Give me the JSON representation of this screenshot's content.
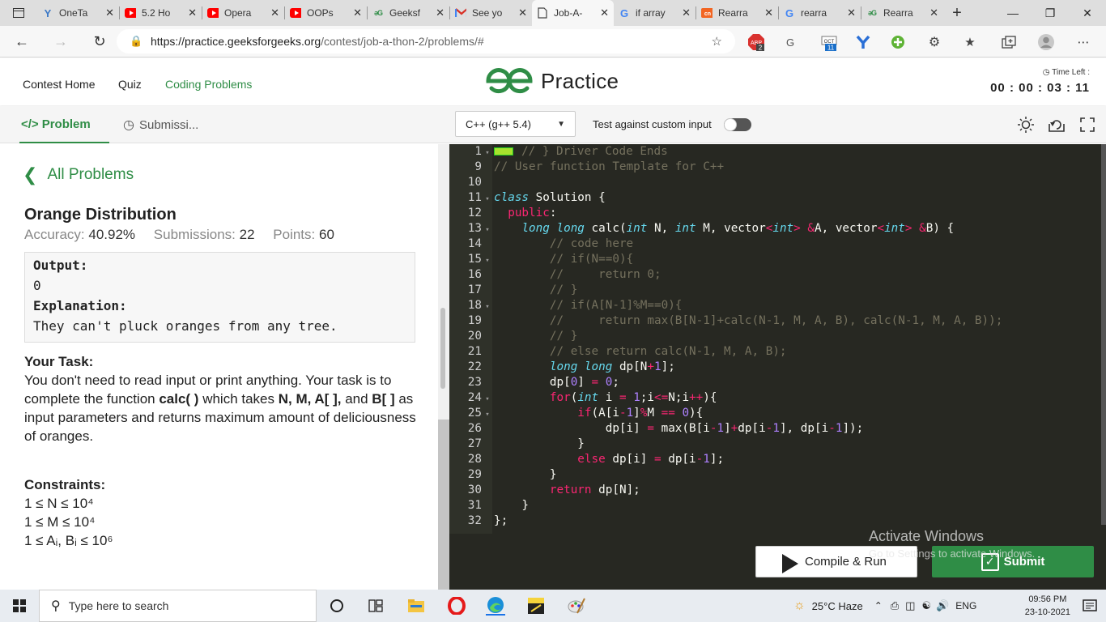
{
  "browser": {
    "tabs": [
      {
        "title": "OneTa",
        "fav": "Y",
        "color": "#3b78c6"
      },
      {
        "title": "5.2 Ho",
        "fav": "youtube",
        "color": "#ff0000"
      },
      {
        "title": "Opera",
        "fav": "youtube",
        "color": "#ff0000"
      },
      {
        "title": "OOPs",
        "fav": "youtube",
        "color": "#ff0000"
      },
      {
        "title": "Geeksf",
        "fav": "gfg",
        "color": "#2f8d46"
      },
      {
        "title": "See yo",
        "fav": "gmail",
        "color": "#d93025"
      },
      {
        "title": "Job-A-",
        "fav": "doc",
        "color": "#444444",
        "active": true
      },
      {
        "title": "if array",
        "fav": "G",
        "color": "#4285f4"
      },
      {
        "title": "Rearra",
        "fav": "cn",
        "color": "#f26522"
      },
      {
        "title": "rearra",
        "fav": "G",
        "color": "#4285f4"
      },
      {
        "title": "Rearra",
        "fav": "gfg",
        "color": "#2f8d46"
      }
    ],
    "url_host": "https://practice.geeksforgeeks.org",
    "url_path": "/contest/job-a-thon-2/problems/#",
    "ext_badge_1": "2",
    "ext_badge_2": "11"
  },
  "header": {
    "nav": [
      "Contest Home",
      "Quiz",
      "Coding Problems"
    ],
    "logo_text": "Practice",
    "time_left_label": "Time Left :",
    "time_left_value": "00 : 00 : 03 : 11"
  },
  "toolbar": {
    "problem_tab": "Problem",
    "submissions_tab": "Submissi...",
    "language": "C++ (g++ 5.4)",
    "custom_input_label": "Test against custom input"
  },
  "problem": {
    "back_label": "All Problems",
    "title": "Orange Distribution",
    "accuracy_label": "Accuracy:",
    "accuracy_value": "40.92%",
    "submissions_label": "Submissions:",
    "submissions_value": "22",
    "points_label": "Points:",
    "points_value": "60",
    "output_label": "Output:",
    "output_value": "0",
    "explanation_label": "Explanation:",
    "explanation_value": "They can't pluck oranges from any tree.",
    "task_heading": "Your Task:",
    "task_text_1": "You don't need to read input or print anything. Your task is to complete the function ",
    "task_fn": "calc( )",
    "task_text_2": " which takes ",
    "task_params": "N, M, A[ ],",
    "task_text_3": "  and ",
    "task_param_b": "B[ ]",
    "task_text_4": "  as input parameters and returns maximum amount of deliciousness of oranges.",
    "constraints_heading": "Constraints:",
    "constraints": [
      "1 ≤ N ≤ 10⁴",
      "1 ≤ M ≤ 10⁴",
      "1 ≤ Aᵢ, Bᵢ ≤ 10⁶"
    ]
  },
  "editor": {
    "lines": [
      {
        "n": "1",
        "fold": true,
        "html": "<span class='cm'>// } Driver Code Ends</span>"
      },
      {
        "n": "9",
        "html": "<span class='cm'>// User function Template for C++</span>"
      },
      {
        "n": "10",
        "html": ""
      },
      {
        "n": "11",
        "fold": true,
        "html": "<span class='kw'>class</span> Solution {"
      },
      {
        "n": "12",
        "html": "  <span class='kw2'>public</span>:"
      },
      {
        "n": "13",
        "fold": true,
        "html": "    <span class='ty'>long long</span> calc(<span class='ty'>int</span> N, <span class='ty'>int</span> M, vector<span class='op'>&lt;</span><span class='ty'>int</span><span class='op'>&gt;</span> <span class='op'>&amp;</span>A, vector<span class='op'>&lt;</span><span class='ty'>int</span><span class='op'>&gt;</span> <span class='op'>&amp;</span>B) {"
      },
      {
        "n": "14",
        "html": "        <span class='cm'>// code here</span>"
      },
      {
        "n": "15",
        "fold": true,
        "html": "        <span class='cm'>// if(N==0){</span>"
      },
      {
        "n": "16",
        "html": "        <span class='cm'>//     return 0;</span>"
      },
      {
        "n": "17",
        "html": "        <span class='cm'>// }</span>"
      },
      {
        "n": "18",
        "fold": true,
        "html": "        <span class='cm'>// if(A[N-1]%M==0){</span>"
      },
      {
        "n": "19",
        "html": "        <span class='cm'>//     return max(B[N-1]+calc(N-1, M, A, B), calc(N-1, M, A, B));</span>"
      },
      {
        "n": "20",
        "html": "        <span class='cm'>// }</span>"
      },
      {
        "n": "21",
        "html": "        <span class='cm'>// else return calc(N-1, M, A, B);</span>"
      },
      {
        "n": "22",
        "html": "        <span class='ty'>long long</span> dp[N<span class='op'>+</span><span class='num'>1</span>];"
      },
      {
        "n": "23",
        "html": "        dp[<span class='num'>0</span>] <span class='op'>=</span> <span class='num'>0</span>;"
      },
      {
        "n": "24",
        "fold": true,
        "html": "        <span class='kw2'>for</span>(<span class='ty'>int</span> i <span class='op'>=</span> <span class='num'>1</span>;i<span class='op'>&lt;=</span>N;i<span class='op'>++</span>){"
      },
      {
        "n": "25",
        "fold": true,
        "html": "            <span class='kw2'>if</span>(A[i<span class='op'>-</span><span class='num'>1</span>]<span class='op'>%</span>M <span class='op'>==</span> <span class='num'>0</span>){"
      },
      {
        "n": "26",
        "html": "                dp[i] <span class='op'>=</span> max(B[i<span class='op'>-</span><span class='num'>1</span>]<span class='op'>+</span>dp[i<span class='op'>-</span><span class='num'>1</span>], dp[i<span class='op'>-</span><span class='num'>1</span>]);"
      },
      {
        "n": "27",
        "html": "            }"
      },
      {
        "n": "28",
        "html": "            <span class='kw2'>else</span> dp[i] <span class='op'>=</span> dp[i<span class='op'>-</span><span class='num'>1</span>];"
      },
      {
        "n": "29",
        "html": "        }"
      },
      {
        "n": "30",
        "html": "        <span class='kw2'>return</span> dp[N];"
      },
      {
        "n": "31",
        "html": "    }"
      },
      {
        "n": "32",
        "html": "};"
      }
    ]
  },
  "actions": {
    "compile_label": "Compile & Run",
    "submit_label": "Submit"
  },
  "watermark": {
    "line1": "Activate Windows",
    "line2": "Go to Settings to activate Windows."
  },
  "taskbar": {
    "search_placeholder": "Type here to search",
    "weather": "25°C  Haze",
    "lang": "ENG",
    "time": "09:56 PM",
    "date": "23-10-2021"
  },
  "colors": {
    "brand_green": "#2f8d46",
    "editor_bg": "#272822"
  }
}
